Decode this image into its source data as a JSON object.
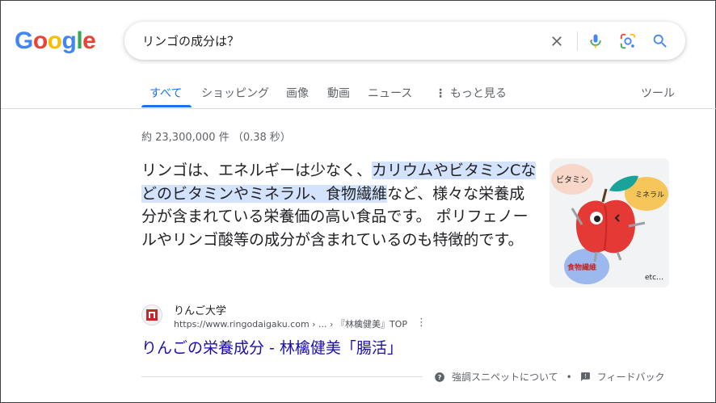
{
  "logo": {
    "letters": [
      "G",
      "o",
      "o",
      "g",
      "l",
      "e"
    ],
    "colors": [
      "#4285F4",
      "#EA4335",
      "#FBBC05",
      "#4285F4",
      "#34A853",
      "#EA4335"
    ]
  },
  "search": {
    "query": "リンゴの成分は？"
  },
  "icons": {
    "clear": "close-icon",
    "voice": "mic-icon",
    "lens": "camera-lens-icon",
    "search": "search-icon"
  },
  "tabs": [
    {
      "label": "すべて",
      "active": true
    },
    {
      "label": "ショッピング"
    },
    {
      "label": "画像"
    },
    {
      "label": "動画"
    },
    {
      "label": "ニュース"
    },
    {
      "label": "もっと見る"
    }
  ],
  "tools_label": "ツール",
  "stats": "約 23,300,000 件 （0.38 秒）",
  "snippet": {
    "before": "リンゴは、エネルギーは少なく、",
    "highlight": "カリウムやビタミンCなどのビタミンやミネラル、食物繊維",
    "after": "など、様々な栄養成分が含まれている栄養価の高い食品です。 ポリフェノールやリンゴ酸等の成分が含まれているのも特徴的です。"
  },
  "thumbnail": {
    "labels": [
      "ビタミン",
      "ミネラル",
      "食物繊維",
      "etc…"
    ]
  },
  "result": {
    "site_name": "りんご大学",
    "url": "https://www.ringodaigaku.com › ... › 『林檎健美』TOP",
    "title": "りんごの栄養成分 - 林檎健美「腸活」"
  },
  "footer": {
    "about": "強調スニペットについて",
    "separator": "•",
    "feedback": "フィードバック"
  },
  "accent_colors": {
    "link": "#1a0dab",
    "tab_active": "#1a73e8",
    "highlight": "#d3e3fd"
  }
}
